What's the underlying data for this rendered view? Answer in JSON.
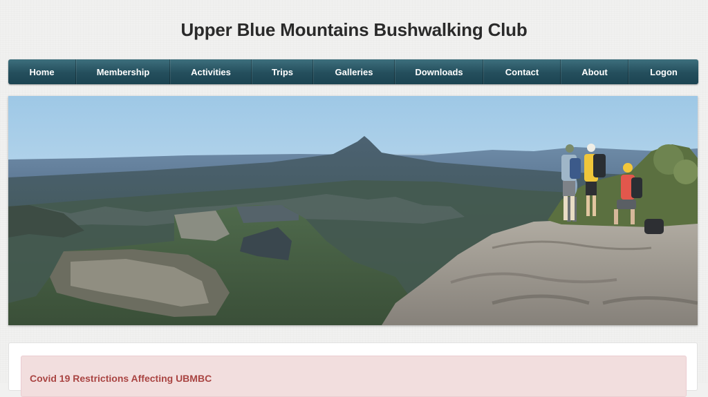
{
  "site": {
    "title": "Upper Blue Mountains Bushwalking Club"
  },
  "nav": {
    "items": [
      {
        "label": "Home"
      },
      {
        "label": "Membership"
      },
      {
        "label": "Activities"
      },
      {
        "label": "Trips"
      },
      {
        "label": "Galleries"
      },
      {
        "label": "Downloads"
      },
      {
        "label": "Contact"
      },
      {
        "label": "About"
      },
      {
        "label": "Logon"
      }
    ]
  },
  "notice": {
    "title": "Covid 19 Restrictions Affecting UBMBC"
  },
  "colors": {
    "nav_background": "#244e5c",
    "notice_background": "#f2dede",
    "notice_text": "#a94442",
    "title_text": "#2a2a2a"
  }
}
